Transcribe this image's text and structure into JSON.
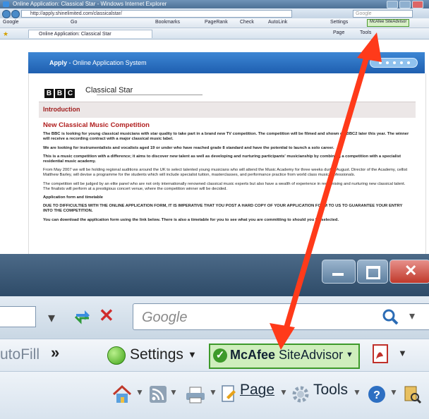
{
  "browser": {
    "title": "Online Application: Classical Star - Windows Internet Explorer",
    "address": "http://apply.shinelimited.com/classicalstar/",
    "search_small_placeholder": "Google",
    "google_toolbar": [
      "Google",
      "Go",
      "Bookmarks",
      "PageRank",
      "Check",
      "AutoLink",
      "Settings",
      "McAfee SiteAdvisor"
    ],
    "tab_label": "Online Application: Classical Star",
    "command_items": [
      "Page",
      "Tools"
    ]
  },
  "page": {
    "apply_label": "Apply",
    "apply_sub": "- Online Application System",
    "bbc_letters": [
      "B",
      "B",
      "C"
    ],
    "brand_title": "Classical Star",
    "section_title": "Introduction",
    "heading": "New Classical Music Competition",
    "paragraphs": [
      {
        "bold": true,
        "text": "The BBC is looking for young classical musicians with star quality to take part in a brand new TV competition. The competition will be filmed and shown on BBC2 later this year. The winner will receive a recording contract with a major classical music label."
      },
      {
        "bold": true,
        "text": "We are looking for instrumentalists and vocalists aged 19 or under who have reached grade 8 standard and have the potential to launch a solo career."
      },
      {
        "bold": true,
        "text": "This is a music competition with a difference; it aims to discover new talent as well as developing and nurturing participants' musicianship by combining a competition with a specialist residential music academy."
      },
      {
        "bold": false,
        "text": "From May 2007 we will be holding regional auditions around the UK to select talented young musicians who will attend the Music Academy for three weeks during August. Director of the Academy, cellist Matthew Barley, will devise a programme for the students which will include specialist tuition, masterclasses, and performance practice from world class music professionals."
      },
      {
        "bold": false,
        "text": "The competition will be judged by an elite panel who are not only internationally renowned classical music experts but also have a wealth of experience in recognising and nurturing new classical talent. The finalists will perform at a prestigious concert venue, where the competition winner will be decided."
      },
      {
        "bold": true,
        "text": "Application form and timetable"
      },
      {
        "bold": true,
        "text": "DUE TO DIFFICULTIES WITH THE ONLINE APPLICATION FORM, IT IS IMPERATIVE THAT YOU POST A HARD COPY OF YOUR APPLICATION FORM TO US TO GUARANTEE YOUR ENTRY INTO THE COMPETITION."
      },
      {
        "bold": true,
        "text": "You can download the application form using the link below. There is also a timetable for you to see what you are committing to should you be selected."
      }
    ]
  },
  "zoom": {
    "search_placeholder": "Google",
    "autofill_label": "utoFill",
    "chevron": "»",
    "settings_label": "Settings",
    "mcafee_brand": "McAfee",
    "mcafee_product": "SiteAdvisor",
    "page_label": "Page",
    "tools_label": "Tools"
  },
  "colors": {
    "arrow": "#ff3a1a",
    "apply_bar": "#2a6ec3",
    "heading_red": "#b01e1e",
    "mcafee_green": "#3d9a2a"
  }
}
